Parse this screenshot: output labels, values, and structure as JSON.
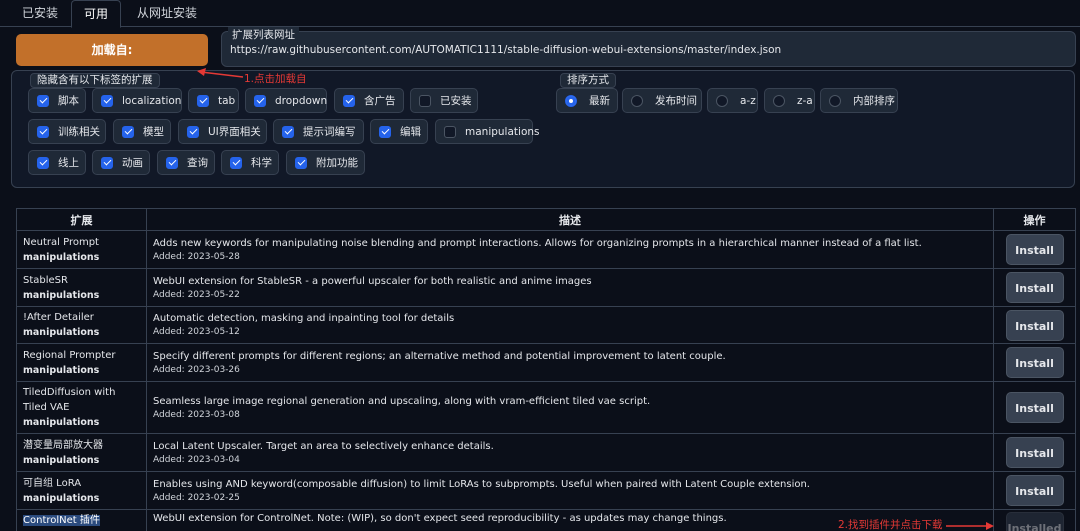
{
  "tabs": [
    {
      "label": "已安装"
    },
    {
      "label": "可用"
    },
    {
      "label": "从网址安装"
    }
  ],
  "load_button": {
    "label": "加载自:"
  },
  "url_field": {
    "label": "扩展列表网址",
    "value": "https://raw.githubusercontent.com/AUTOMATIC1111/stable-diffusion-webui-extensions/master/index.json"
  },
  "hide_tags": {
    "label": "隐藏含有以下标签的扩展",
    "items": [
      {
        "label": "脚本",
        "checked": true
      },
      {
        "label": "localization",
        "checked": true
      },
      {
        "label": "tab",
        "checked": true
      },
      {
        "label": "dropdown",
        "checked": true
      },
      {
        "label": "含广告",
        "checked": true
      },
      {
        "label": "已安装",
        "checked": false
      },
      {
        "label": "训练相关",
        "checked": true
      },
      {
        "label": "模型",
        "checked": true
      },
      {
        "label": "UI界面相关",
        "checked": true
      },
      {
        "label": "提示词编写",
        "checked": true
      },
      {
        "label": "编辑",
        "checked": true
      },
      {
        "label": "manipulations",
        "checked": false
      },
      {
        "label": "线上",
        "checked": true
      },
      {
        "label": "动画",
        "checked": true
      },
      {
        "label": "查询",
        "checked": true
      },
      {
        "label": "科学",
        "checked": true
      },
      {
        "label": "附加功能",
        "checked": true
      }
    ]
  },
  "sort": {
    "label": "排序方式",
    "options": [
      {
        "label": "最新",
        "selected": true
      },
      {
        "label": "发布时间",
        "selected": false
      },
      {
        "label": "a-z",
        "selected": false
      },
      {
        "label": "z-a",
        "selected": false
      },
      {
        "label": "内部排序",
        "selected": false
      }
    ]
  },
  "annotations": {
    "step1": "1.点击加载自",
    "step2": "2.找到插件并点击下载",
    "color": "#e53935"
  },
  "table": {
    "headers": {
      "name": "扩展",
      "desc": "描述",
      "action": "操作"
    },
    "rows": [
      {
        "name": "Neutral Prompt",
        "tag": "manipulations",
        "desc": "Adds new keywords for manipulating noise blending and prompt interactions. Allows for organizing prompts in a hierarchical manner instead of a flat list.",
        "added": "Added: 2023-05-28",
        "action": "Install"
      },
      {
        "name": "StableSR",
        "tag": "manipulations",
        "desc": "WebUI extension for StableSR - a powerful upscaler for both realistic and anime images",
        "added": "Added: 2023-05-22",
        "action": "Install"
      },
      {
        "name": "!After Detailer",
        "tag": "manipulations",
        "desc": "Automatic detection, masking and inpainting tool for details",
        "added": "Added: 2023-05-12",
        "action": "Install"
      },
      {
        "name": "Regional Prompter",
        "tag": "manipulations",
        "desc": "Specify different prompts for different regions; an alternative method and potential improvement to latent couple.",
        "added": "Added: 2023-03-26",
        "action": "Install"
      },
      {
        "name": "TiledDiffusion with Tiled VAE",
        "tag": "manipulations",
        "desc": "Seamless large image regional generation and upscaling, along with vram-efficient tiled vae script.",
        "added": "Added: 2023-03-08",
        "action": "Install"
      },
      {
        "name": "潜变量局部放大器",
        "tag": "manipulations",
        "desc": "Local Latent Upscaler. Target an area to selectively enhance details.",
        "added": "Added: 2023-03-04",
        "action": "Install"
      },
      {
        "name": "可自组 LoRA",
        "tag": "manipulations",
        "desc": "Enables using AND keyword(composable diffusion) to limit LoRAs to subprompts. Useful when paired with Latent Couple extension.",
        "added": "Added: 2023-02-25",
        "action": "Install"
      },
      {
        "name": "ControlNet 插件",
        "tag": "",
        "desc": "WebUI extension for ControlNet. Note: (WIP), so don't expect seed reproducibility - as updates may change things.",
        "added": "",
        "action": "Installed"
      }
    ]
  }
}
